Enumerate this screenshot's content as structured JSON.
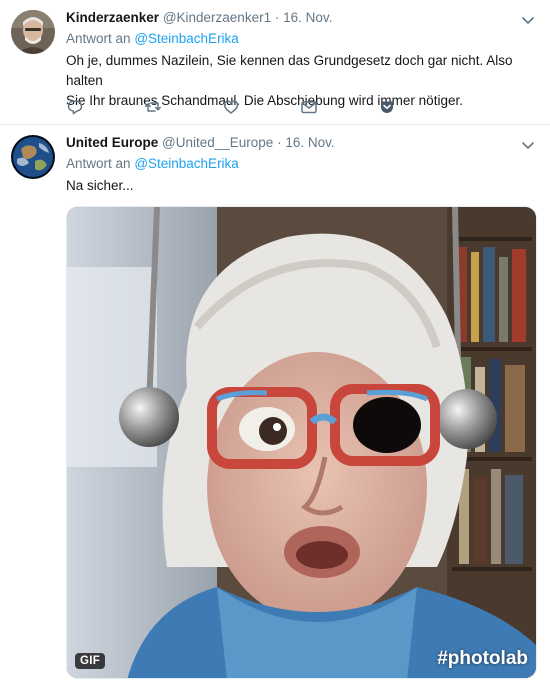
{
  "tweets": [
    {
      "name": "Kinderzaenker",
      "handle": "@Kinderzaenker1",
      "separator": "·",
      "date": "16. Nov.",
      "reply_prefix": "Antwort an",
      "reply_mention": "@SteinbachErika",
      "text_line1": "Oh je, dummes Nazilein, Sie kennen das Grundgesetz doch gar nicht. Also halten",
      "text_line2": "Sie Ihr braunes Schandmaul. Die Abschiebung wird immer nötiger.",
      "actions": [
        "reply-icon",
        "retweet-icon",
        "like-icon",
        "message-icon",
        "bookmark-icon"
      ]
    },
    {
      "name": "United Europe",
      "handle": "@United__Europe",
      "separator": "·",
      "date": "16. Nov.",
      "reply_prefix": "Antwort an",
      "reply_mention": "@SteinbachErika",
      "text_line1": "Na sicher...",
      "media": {
        "badge": "GIF",
        "watermark": "#photolab"
      }
    }
  ],
  "colors": {
    "link": "#1da1f2",
    "secondary_text": "#657786",
    "divider": "#e6ecf0",
    "icon": "#657786"
  }
}
